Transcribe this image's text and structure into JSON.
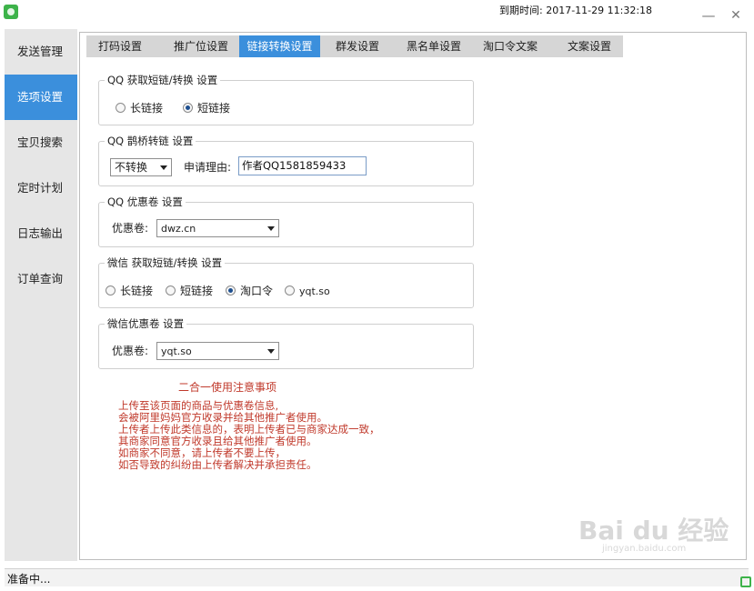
{
  "window": {
    "expire_label": "到期时间: 2017-11-29 11:32:18",
    "minimize_glyph": "—",
    "close_glyph": "✕"
  },
  "sidebar": {
    "items": [
      {
        "label": "发送管理",
        "active": false
      },
      {
        "label": "选项设置",
        "active": true
      },
      {
        "label": "宝贝搜索",
        "active": false
      },
      {
        "label": "定时计划",
        "active": false
      },
      {
        "label": "日志输出",
        "active": false
      },
      {
        "label": "订单查询",
        "active": false
      }
    ]
  },
  "tabs": [
    {
      "label": "打码设置",
      "active": false
    },
    {
      "label": "推广位设置",
      "active": false
    },
    {
      "label": "链接转换设置",
      "active": true
    },
    {
      "label": "群发设置",
      "active": false
    },
    {
      "label": "黑名单设置",
      "active": false
    },
    {
      "label": "淘口令文案",
      "active": false
    },
    {
      "label": "文案设置",
      "active": false
    }
  ],
  "qq_link": {
    "title": "QQ 获取短链/转换 设置",
    "options": [
      {
        "label": "长链接",
        "checked": false
      },
      {
        "label": "短链接",
        "checked": true
      }
    ]
  },
  "qq_bridge": {
    "title": "QQ 鹊桥转链 设置",
    "select_value": "不转换",
    "reason_label": "申请理由:",
    "reason_value": "作者QQ1581859433"
  },
  "qq_coupon": {
    "title": "QQ 优惠卷 设置",
    "label": "优惠卷:",
    "value": "dwz.cn"
  },
  "wechat_link": {
    "title": "微信 获取短链/转换 设置",
    "options": [
      {
        "label": "长链接",
        "checked": false
      },
      {
        "label": "短链接",
        "checked": false
      },
      {
        "label": "淘口令",
        "checked": true
      },
      {
        "label": "yqt.so",
        "checked": false
      }
    ]
  },
  "wechat_coupon": {
    "title": "微信优惠卷 设置",
    "label": "优惠卷:",
    "value": "yqt.so"
  },
  "notes": {
    "title": "二合一使用注意事项",
    "lines": [
      "上传至该页面的商品与优惠卷信息,",
      "会被阿里妈妈官方收录并给其他推广者使用。",
      "上传者上传此类信息的，表明上传者已与商家达成一致，",
      "其商家同意官方收录且给其他推广者使用。",
      "如商家不同意，请上传者不要上传，",
      "如否导致的纠纷由上传者解决并承担责任。"
    ]
  },
  "watermark": {
    "text": "Bai du 经验",
    "sub": "jingyan.baidu.com"
  },
  "status": {
    "text": "准备中..."
  },
  "colors": {
    "accent": "#3b8fdc",
    "notes_red": "#c0392b",
    "sidebar_bg": "#e6e6e6"
  }
}
